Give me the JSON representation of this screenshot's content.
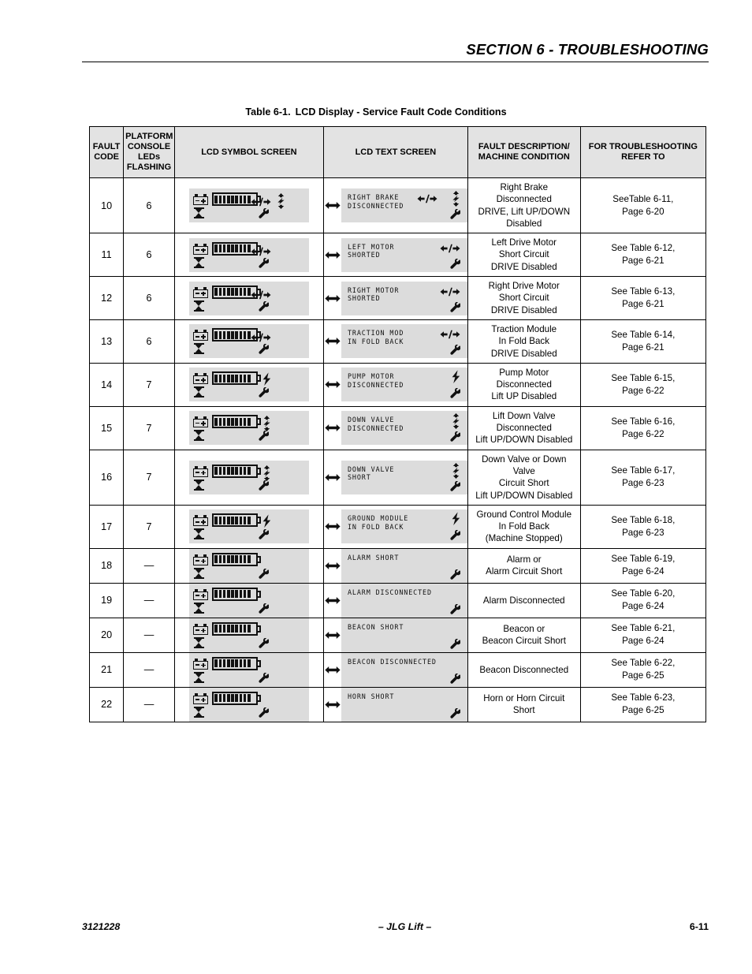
{
  "header": {
    "section_title": "SECTION 6 - TROUBLESHOOTING"
  },
  "caption": {
    "label": "Table 6-1.",
    "title": "LCD Display -  Service Fault Code Conditions"
  },
  "table": {
    "columns": [
      "FAULT CODE",
      "PLATFORM CONSOLE LEDs FLASHING",
      "LCD SYMBOL SCREEN",
      "LCD TEXT SCREEN",
      "FAULT DESCRIPTION/ MACHINE CONDITION",
      "FOR TROUBLESHOOTING REFER TO"
    ],
    "headers": {
      "fault_code_l1": "FAULT",
      "fault_code_l2": "CODE",
      "leds_l1": "PLATFORM",
      "leds_l2": "CONSOLE",
      "leds_l3": "LEDs",
      "leds_l4": "FLASHING",
      "symbol_screen": "LCD SYMBOL SCREEN",
      "text_screen": "LCD TEXT SCREEN",
      "description_l1": "FAULT DESCRIPTION/",
      "description_l2": "MACHINE CONDITION",
      "refer_l1": "FOR TROUBLESHOOTING",
      "refer_l2": "REFER TO"
    },
    "rows": [
      {
        "fault_code": "10",
        "leds": "6",
        "symbol_icons": [
          "battery",
          "hourglass",
          "drive",
          "bolt-updown",
          "wrench"
        ],
        "lcd_line1": "RIGHT BRAKE",
        "lcd_line2": "DISCONNECTED",
        "text_icons": [
          "drive",
          "bolt-updown",
          "wrench"
        ],
        "description_l1": "Right Brake Disconnected",
        "description_l2": "DRIVE, Lift UP/DOWN",
        "description_l3": "Disabled",
        "refer_l1": "SeeTable 6-11,",
        "refer_l2": "Page 6-20"
      },
      {
        "fault_code": "11",
        "leds": "6",
        "symbol_icons": [
          "battery",
          "hourglass",
          "drive",
          "wrench"
        ],
        "lcd_line1": "LEFT MOTOR",
        "lcd_line2": "SHORTED",
        "text_icons": [
          "drive",
          "wrench"
        ],
        "description_l1": "Left Drive Motor",
        "description_l2": "Short Circuit",
        "description_l3": "DRIVE Disabled",
        "refer_l1": "See Table 6-12,",
        "refer_l2": "Page 6-21"
      },
      {
        "fault_code": "12",
        "leds": "6",
        "symbol_icons": [
          "battery",
          "hourglass",
          "drive",
          "wrench"
        ],
        "lcd_line1": "RIGHT MOTOR",
        "lcd_line2": "SHORTED",
        "text_icons": [
          "drive",
          "wrench"
        ],
        "description_l1": "Right Drive Motor",
        "description_l2": "Short Circuit",
        "description_l3": "DRIVE Disabled",
        "refer_l1": "See Table 6-13,",
        "refer_l2": "Page 6-21"
      },
      {
        "fault_code": "13",
        "leds": "6",
        "symbol_icons": [
          "battery",
          "hourglass",
          "drive",
          "wrench"
        ],
        "lcd_line1": "TRACTION MOD",
        "lcd_line2": "IN FOLD BACK",
        "text_icons": [
          "drive",
          "wrench"
        ],
        "description_l1": "Traction Module",
        "description_l2": "In Fold Back",
        "description_l3": "DRIVE Disabled",
        "refer_l1": "See Table 6-14,",
        "refer_l2": "Page 6-21"
      },
      {
        "fault_code": "14",
        "leds": "7",
        "symbol_icons": [
          "battery",
          "hourglass",
          "bolt-up",
          "wrench"
        ],
        "lcd_line1": "PUMP MOTOR",
        "lcd_line2": "DISCONNECTED",
        "text_icons": [
          "bolt-up",
          "wrench"
        ],
        "description_l1": "Pump Motor Disconnected",
        "description_l2": "Lift UP Disabled",
        "description_l3": "",
        "refer_l1": "See Table 6-15,",
        "refer_l2": "Page 6-22"
      },
      {
        "fault_code": "15",
        "leds": "7",
        "symbol_icons": [
          "battery",
          "hourglass",
          "bolt-updown",
          "wrench"
        ],
        "lcd_line1": "DOWN VALVE",
        "lcd_line2": "DISCONNECTED",
        "text_icons": [
          "bolt-updown",
          "wrench"
        ],
        "description_l1": "Lift Down Valve",
        "description_l2": "Disconnected",
        "description_l3": "Lift UP/DOWN Disabled",
        "refer_l1": "See Table 6-16,",
        "refer_l2": "Page 6-22"
      },
      {
        "fault_code": "16",
        "leds": "7",
        "symbol_icons": [
          "battery",
          "hourglass",
          "bolt-updown",
          "wrench"
        ],
        "lcd_line1": "DOWN VALVE",
        "lcd_line2": "SHORT",
        "text_icons": [
          "bolt-updown",
          "wrench"
        ],
        "description_l1": "Down Valve or Down Valve",
        "description_l2": "Circuit Short",
        "description_l3": "Lift UP/DOWN Disabled",
        "refer_l1": "See Table 6-17,",
        "refer_l2": "Page 6-23"
      },
      {
        "fault_code": "17",
        "leds": "7",
        "symbol_icons": [
          "battery",
          "hourglass",
          "bolt-up",
          "wrench"
        ],
        "lcd_line1": "GROUND MODULE",
        "lcd_line2": "IN FOLD BACK",
        "text_icons": [
          "bolt-up",
          "wrench"
        ],
        "description_l1": "Ground Control Module",
        "description_l2": "In Fold Back",
        "description_l3": "(Machine Stopped)",
        "refer_l1": "See Table 6-18,",
        "refer_l2": "Page 6-23"
      },
      {
        "fault_code": "18",
        "leds": "—",
        "symbol_icons": [
          "battery",
          "hourglass",
          "wrench"
        ],
        "lcd_line1": "ALARM SHORT",
        "lcd_line2": "",
        "text_icons": [
          "wrench"
        ],
        "description_l1": "Alarm or",
        "description_l2": "Alarm Circuit Short",
        "description_l3": "",
        "refer_l1": "See Table 6-19,",
        "refer_l2": "Page 6-24"
      },
      {
        "fault_code": "19",
        "leds": "—",
        "symbol_icons": [
          "battery",
          "hourglass",
          "wrench"
        ],
        "lcd_line1": "ALARM DISCONNECTED",
        "lcd_line2": "",
        "text_icons": [
          "wrench"
        ],
        "description_l1": "Alarm Disconnected",
        "description_l2": "",
        "description_l3": "",
        "refer_l1": "See Table 6-20,",
        "refer_l2": "Page 6-24"
      },
      {
        "fault_code": "20",
        "leds": "—",
        "symbol_icons": [
          "battery",
          "hourglass",
          "wrench"
        ],
        "lcd_line1": "BEACON SHORT",
        "lcd_line2": "",
        "text_icons": [
          "wrench"
        ],
        "description_l1": "Beacon or",
        "description_l2": "Beacon Circuit Short",
        "description_l3": "",
        "refer_l1": "See Table 6-21,",
        "refer_l2": "Page 6-24"
      },
      {
        "fault_code": "21",
        "leds": "—",
        "symbol_icons": [
          "battery",
          "hourglass",
          "wrench"
        ],
        "lcd_line1": "BEACON DISCONNECTED",
        "lcd_line2": "",
        "text_icons": [
          "wrench"
        ],
        "description_l1": "Beacon Disconnected",
        "description_l2": "",
        "description_l3": "",
        "refer_l1": "See Table 6-22,",
        "refer_l2": "Page 6-25"
      },
      {
        "fault_code": "22",
        "leds": "—",
        "symbol_icons": [
          "battery",
          "hourglass",
          "wrench"
        ],
        "lcd_line1": "HORN SHORT",
        "lcd_line2": "",
        "text_icons": [
          "wrench"
        ],
        "description_l1": "Horn or Horn Circuit Short",
        "description_l2": "",
        "description_l3": "",
        "refer_l1": "See Table 6-23,",
        "refer_l2": "Page 6-25"
      }
    ]
  },
  "footer": {
    "doc_number": "3121228",
    "center": "– JLG Lift –",
    "page_number": "6-11"
  },
  "colors": {
    "lcd_background": "#dcdcdc",
    "header_background": "#e3e3e3",
    "ink": "#000000"
  }
}
